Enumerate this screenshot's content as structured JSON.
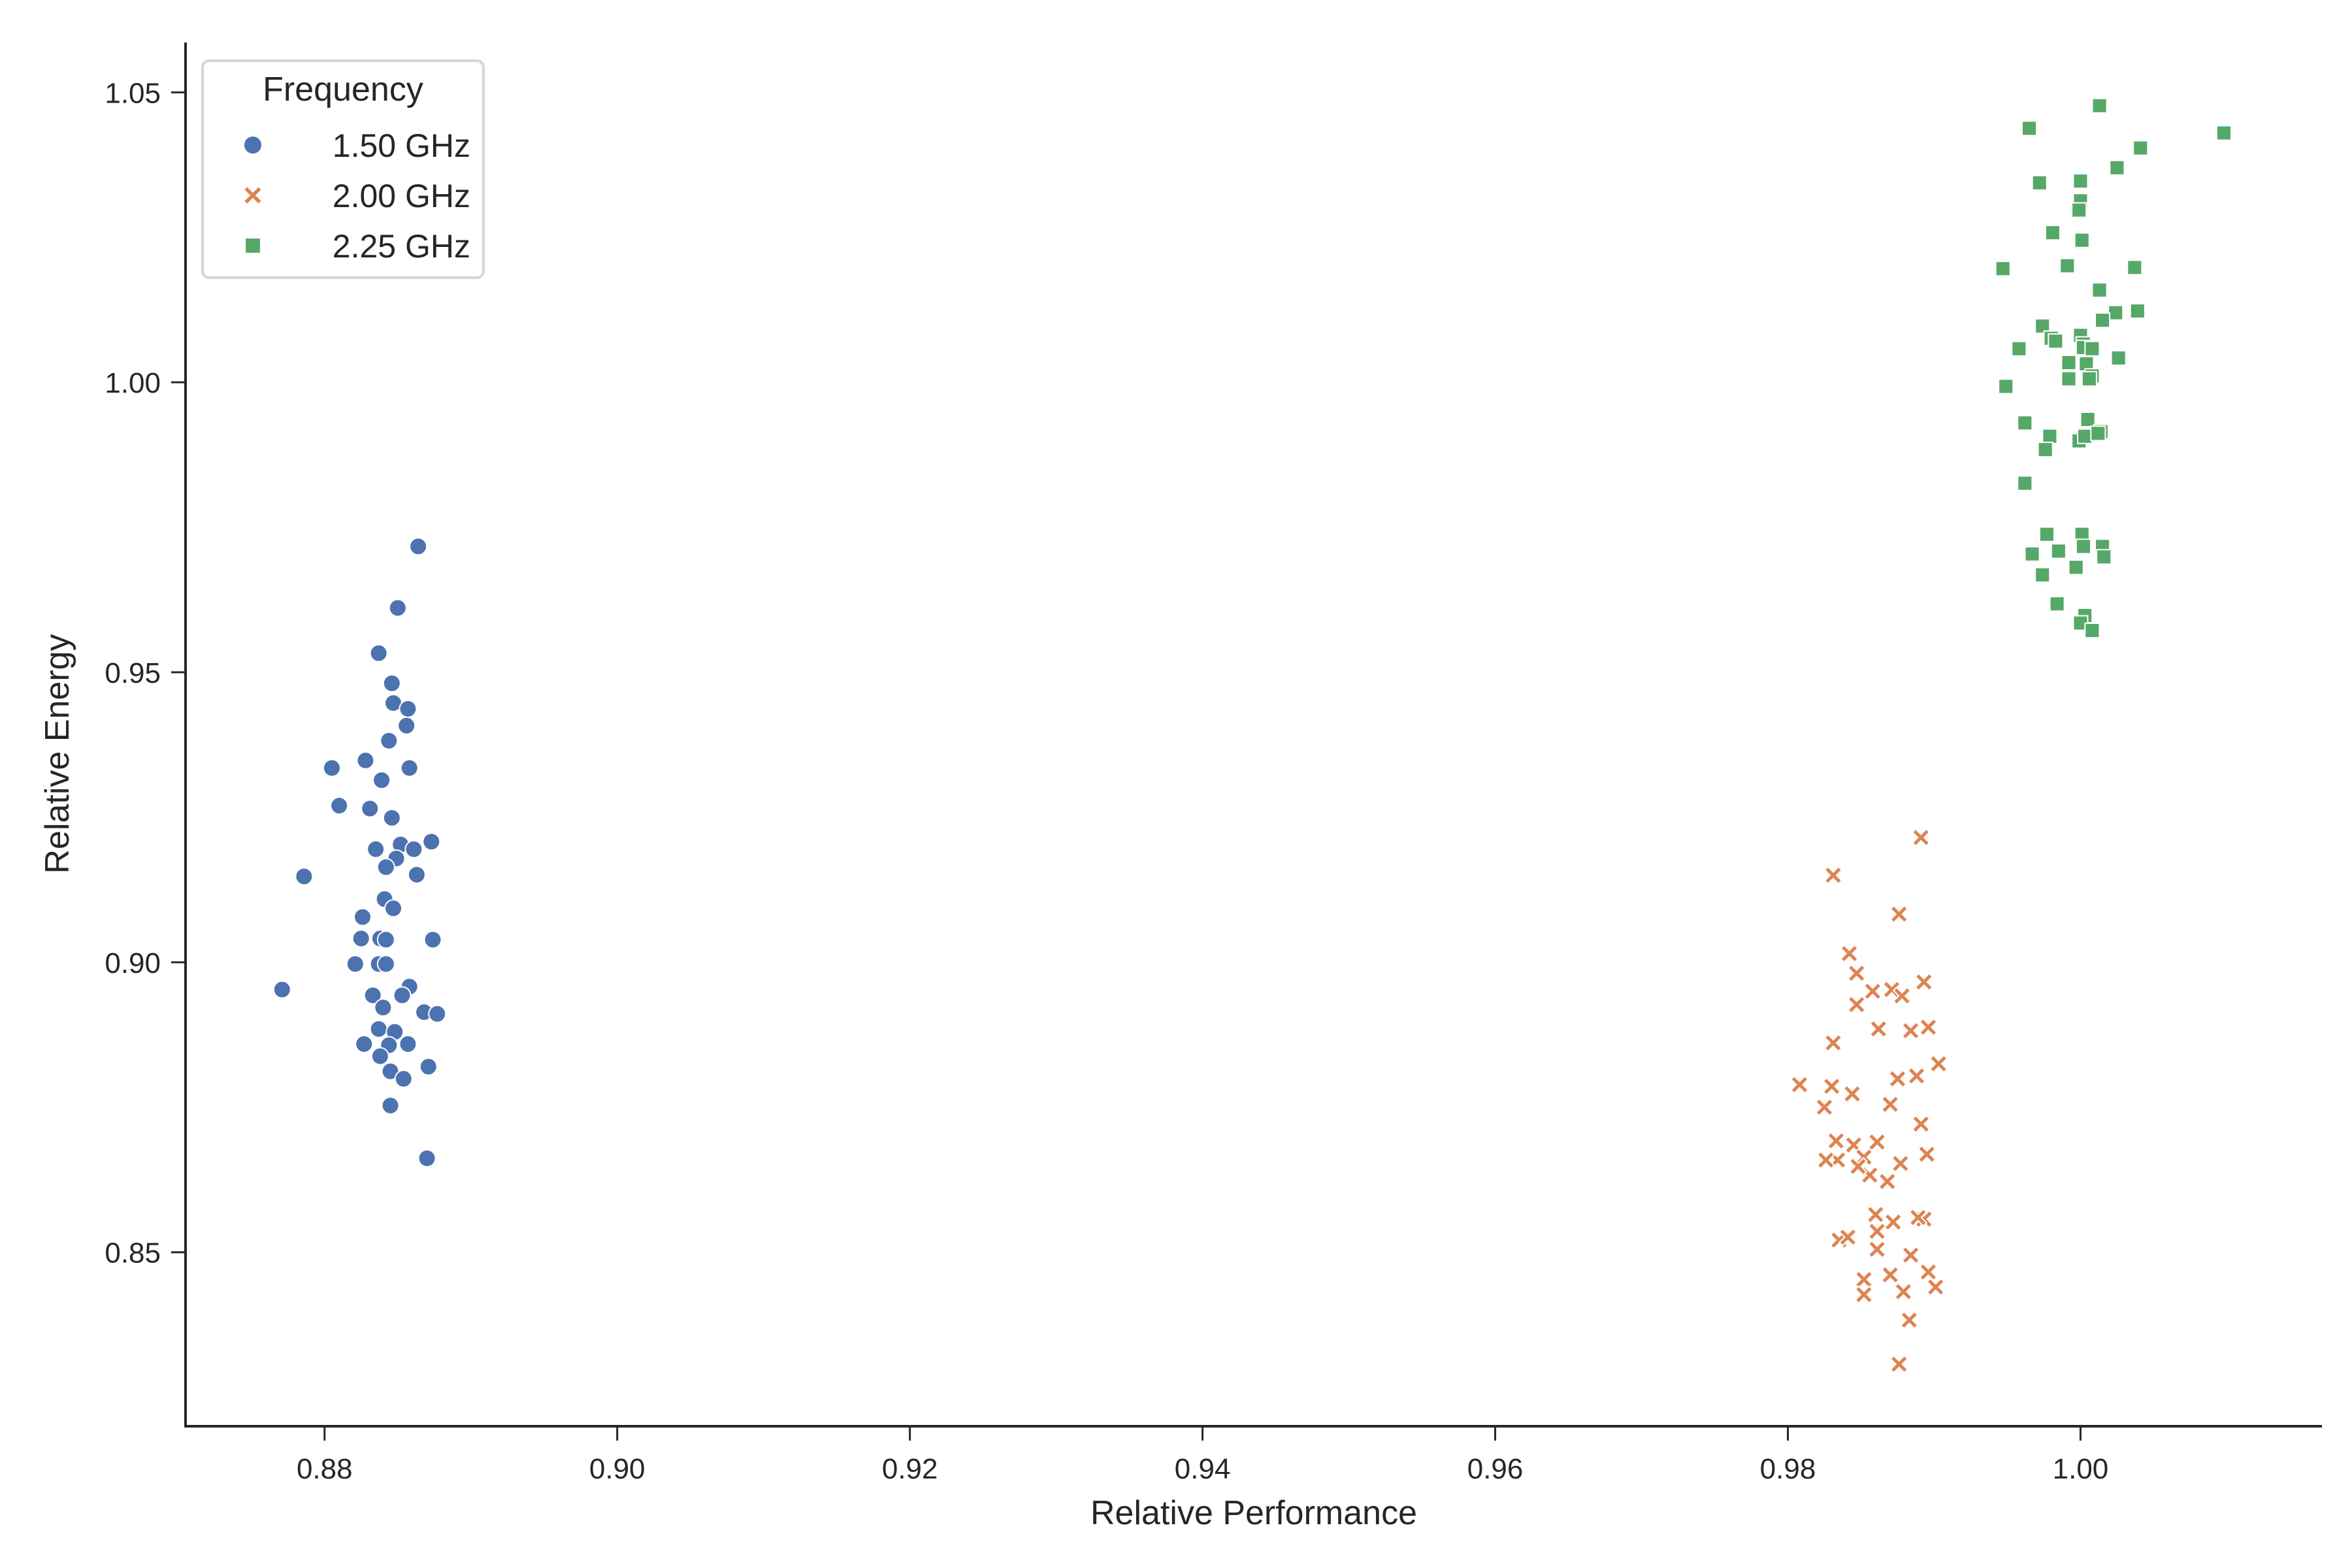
{
  "chart_data": {
    "type": "scatter",
    "title": "",
    "xlabel": "Relative Performance",
    "ylabel": "Relative Energy",
    "xlim": [
      0.8705,
      1.0165
    ],
    "ylim": [
      0.82,
      1.0586
    ],
    "xticks": [
      0.88,
      0.9,
      0.92,
      0.94,
      0.96,
      0.98,
      1.0
    ],
    "xtick_labels": [
      "0.88",
      "0.90",
      "0.92",
      "0.94",
      "0.96",
      "0.98",
      "1.00"
    ],
    "yticks": [
      0.85,
      0.9,
      0.95,
      1.0,
      1.05
    ],
    "ytick_labels": [
      "0.85",
      "0.90",
      "0.95",
      "1.00",
      "1.05"
    ],
    "grid": false,
    "legend": {
      "title": "Frequency",
      "placement": "top-left"
    },
    "series": [
      {
        "name": "1.50 GHz",
        "marker": "circle",
        "color": "#4c72b0",
        "points": [
          [
            0.8864,
            0.9717
          ],
          [
            0.885,
            0.9611
          ],
          [
            0.8837,
            0.9533
          ],
          [
            0.8846,
            0.9481
          ],
          [
            0.8847,
            0.9447
          ],
          [
            0.8857,
            0.9437
          ],
          [
            0.8856,
            0.9408
          ],
          [
            0.8844,
            0.9382
          ],
          [
            0.8828,
            0.9348
          ],
          [
            0.8805,
            0.9335
          ],
          [
            0.8858,
            0.9335
          ],
          [
            0.8839,
            0.9314
          ],
          [
            0.881,
            0.927
          ],
          [
            0.8831,
            0.9265
          ],
          [
            0.8846,
            0.9249
          ],
          [
            0.8873,
            0.9208
          ],
          [
            0.8852,
            0.9203
          ],
          [
            0.8835,
            0.9195
          ],
          [
            0.8861,
            0.9195
          ],
          [
            0.8849,
            0.9179
          ],
          [
            0.8842,
            0.9164
          ],
          [
            0.8863,
            0.9151
          ],
          [
            0.8786,
            0.9148
          ],
          [
            0.8841,
            0.9109
          ],
          [
            0.8847,
            0.9093
          ],
          [
            0.8826,
            0.9078
          ],
          [
            0.8825,
            0.9041
          ],
          [
            0.8838,
            0.9041
          ],
          [
            0.8842,
            0.9039
          ],
          [
            0.8874,
            0.9039
          ],
          [
            0.8821,
            0.8997
          ],
          [
            0.8837,
            0.8997
          ],
          [
            0.8842,
            0.8997
          ],
          [
            0.8771,
            0.8953
          ],
          [
            0.8858,
            0.8958
          ],
          [
            0.8833,
            0.8943
          ],
          [
            0.8853,
            0.8943
          ],
          [
            0.884,
            0.8922
          ],
          [
            0.8868,
            0.8914
          ],
          [
            0.8877,
            0.8911
          ],
          [
            0.8837,
            0.8885
          ],
          [
            0.8848,
            0.888
          ],
          [
            0.8827,
            0.8859
          ],
          [
            0.8844,
            0.8857
          ],
          [
            0.8857,
            0.8859
          ],
          [
            0.8838,
            0.8838
          ],
          [
            0.8871,
            0.882
          ],
          [
            0.8845,
            0.8812
          ],
          [
            0.8854,
            0.8799
          ],
          [
            0.8845,
            0.8753
          ],
          [
            0.887,
            0.8662
          ]
        ]
      },
      {
        "name": "2.00 GHz",
        "marker": "x",
        "color": "#dd8452",
        "points": [
          [
            0.9891,
            0.9215
          ],
          [
            0.9831,
            0.915
          ],
          [
            0.9876,
            0.9083
          ],
          [
            0.9842,
            0.9015
          ],
          [
            0.9847,
            0.8981
          ],
          [
            0.9858,
            0.895
          ],
          [
            0.9893,
            0.8966
          ],
          [
            0.9871,
            0.8953
          ],
          [
            0.9878,
            0.8942
          ],
          [
            0.9847,
            0.8927
          ],
          [
            0.9862,
            0.8885
          ],
          [
            0.9884,
            0.8882
          ],
          [
            0.9896,
            0.8888
          ],
          [
            0.9831,
            0.8861
          ],
          [
            0.9903,
            0.8825
          ],
          [
            0.9875,
            0.8799
          ],
          [
            0.9888,
            0.8804
          ],
          [
            0.9808,
            0.8789
          ],
          [
            0.983,
            0.8786
          ],
          [
            0.9844,
            0.8773
          ],
          [
            0.9825,
            0.875
          ],
          [
            0.987,
            0.8755
          ],
          [
            0.9891,
            0.8721
          ],
          [
            0.9833,
            0.8692
          ],
          [
            0.9845,
            0.8685
          ],
          [
            0.9861,
            0.869
          ],
          [
            0.9834,
            0.8659
          ],
          [
            0.9852,
            0.8664
          ],
          [
            0.9877,
            0.8653
          ],
          [
            0.9895,
            0.8669
          ],
          [
            0.9826,
            0.8659
          ],
          [
            0.9856,
            0.8633
          ],
          [
            0.9868,
            0.8622
          ],
          [
            0.9848,
            0.8648
          ],
          [
            0.986,
            0.8565
          ],
          [
            0.9872,
            0.8552
          ],
          [
            0.9893,
            0.8557
          ],
          [
            0.9861,
            0.8536
          ],
          [
            0.9889,
            0.856
          ],
          [
            0.9835,
            0.8521
          ],
          [
            0.9841,
            0.8526
          ],
          [
            0.9861,
            0.8505
          ],
          [
            0.9884,
            0.8495
          ],
          [
            0.9852,
            0.8453
          ],
          [
            0.987,
            0.8461
          ],
          [
            0.9896,
            0.8466
          ],
          [
            0.9852,
            0.8427
          ],
          [
            0.9879,
            0.8432
          ],
          [
            0.9901,
            0.844
          ],
          [
            0.9883,
            0.8383
          ],
          [
            0.9876,
            0.8307
          ]
        ]
      },
      {
        "name": "2.25 GHz",
        "marker": "square",
        "color": "#55a868",
        "points": [
          [
            0.9965,
            1.0438
          ],
          [
            1.0013,
            1.0477
          ],
          [
            1.0098,
            1.043
          ],
          [
            1.0025,
            1.037
          ],
          [
            1.0041,
            1.0404
          ],
          [
            1.0,
            1.0347
          ],
          [
            0.9972,
            1.0344
          ],
          [
            1.0,
            1.0313
          ],
          [
            0.9999,
            1.0297
          ],
          [
            0.9981,
            1.0258
          ],
          [
            1.0001,
            1.0245
          ],
          [
            0.9947,
            1.0196
          ],
          [
            1.0037,
            1.0198
          ],
          [
            0.9991,
            1.0201
          ],
          [
            1.0013,
            1.0159
          ],
          [
            1.0024,
            1.012
          ],
          [
            1.0039,
            1.0123
          ],
          [
            1.0015,
            1.0107
          ],
          [
            0.9974,
            1.0097
          ],
          [
            1.0,
            1.0081
          ],
          [
            0.998,
            1.0076
          ],
          [
            0.9983,
            1.0071
          ],
          [
            1.0002,
            1.0066
          ],
          [
            0.9958,
            1.0058
          ],
          [
            1.0002,
            1.006
          ],
          [
            1.0008,
            1.0058
          ],
          [
            1.0026,
            1.0042
          ],
          [
            0.9992,
            1.0034
          ],
          [
            1.0004,
            1.0032
          ],
          [
            1.0008,
            1.0011
          ],
          [
            0.9992,
            1.0006
          ],
          [
            1.0006,
            1.0006
          ],
          [
            0.9949,
            0.9993
          ],
          [
            0.9962,
            0.993
          ],
          [
            1.0005,
            0.9936
          ],
          [
            0.9979,
            0.9907
          ],
          [
            0.9999,
            0.9899
          ],
          [
            1.0014,
            0.9915
          ],
          [
            1.0003,
            0.9907
          ],
          [
            0.9976,
            0.9884
          ],
          [
            1.0012,
            0.9912
          ],
          [
            0.9962,
            0.9826
          ],
          [
            0.9977,
            0.9738
          ],
          [
            1.0001,
            0.9738
          ],
          [
            1.0002,
            0.9717
          ],
          [
            1.0015,
            0.9717
          ],
          [
            0.9967,
            0.9704
          ],
          [
            0.9985,
            0.9709
          ],
          [
            1.0016,
            0.9699
          ],
          [
            0.9997,
            0.9681
          ],
          [
            0.9974,
            0.9668
          ],
          [
            0.9984,
            0.9618
          ],
          [
            1.0003,
            0.9598
          ],
          [
            1.0,
            0.9585
          ],
          [
            1.0008,
            0.9572
          ]
        ]
      }
    ]
  }
}
